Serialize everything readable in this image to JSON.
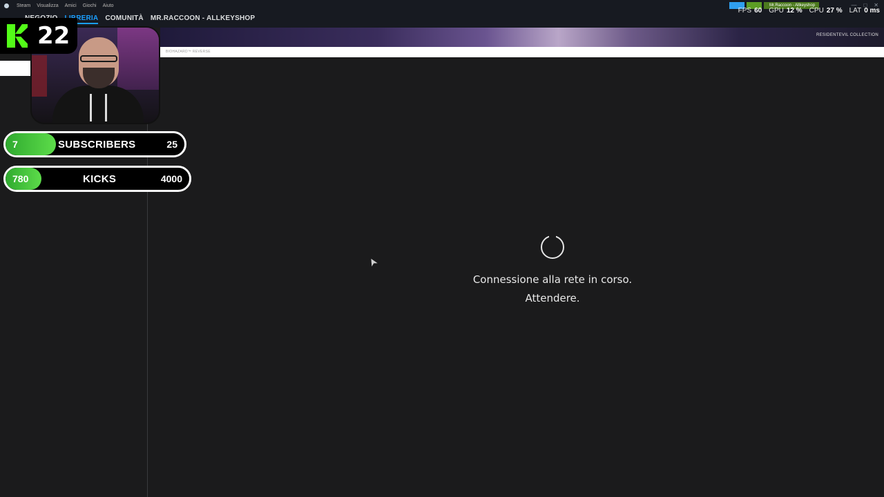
{
  "menu": [
    "Steam",
    "Visualizza",
    "Amici",
    "Giochi",
    "Aiuto"
  ],
  "nav": {
    "back_icon": "arrow-left-icon",
    "forward_icon": "arrow-right-icon",
    "tabs": [
      "NEGOZIO",
      "LIBRERIA",
      "COMUNITÀ",
      "MR.RACCOON - ALLKEYSHOP"
    ],
    "active_tab": "LIBRERIA"
  },
  "user_status": "Mr.Raccoon - Allkeyshop",
  "stats": {
    "fps_label": "FPS",
    "fps": "60",
    "gpu_label": "GPU",
    "gpu": "12 %",
    "cpu_label": "CPU",
    "cpu": "27 %",
    "lat_label": "LAT",
    "lat": "0 ms"
  },
  "banner": {
    "collection_label": "RESIDENTEVIL COLLECTION",
    "subtitle": "BIOHAZARD™ REVERSE"
  },
  "kick": {
    "followers": "22"
  },
  "goals": {
    "subscribers": {
      "current": "7",
      "label": "SUBSCRIBERS",
      "target": "25",
      "progress": 0.28
    },
    "kicks": {
      "current": "780",
      "label": "KICKS",
      "target": "4000",
      "progress": 0.195
    }
  },
  "loading": {
    "line1": "Connessione alla rete in corso.",
    "line2": "Attendere."
  },
  "colors": {
    "accent": "#1a9fff",
    "kick_green": "#53fc18",
    "bg": "#1b1b1c"
  }
}
